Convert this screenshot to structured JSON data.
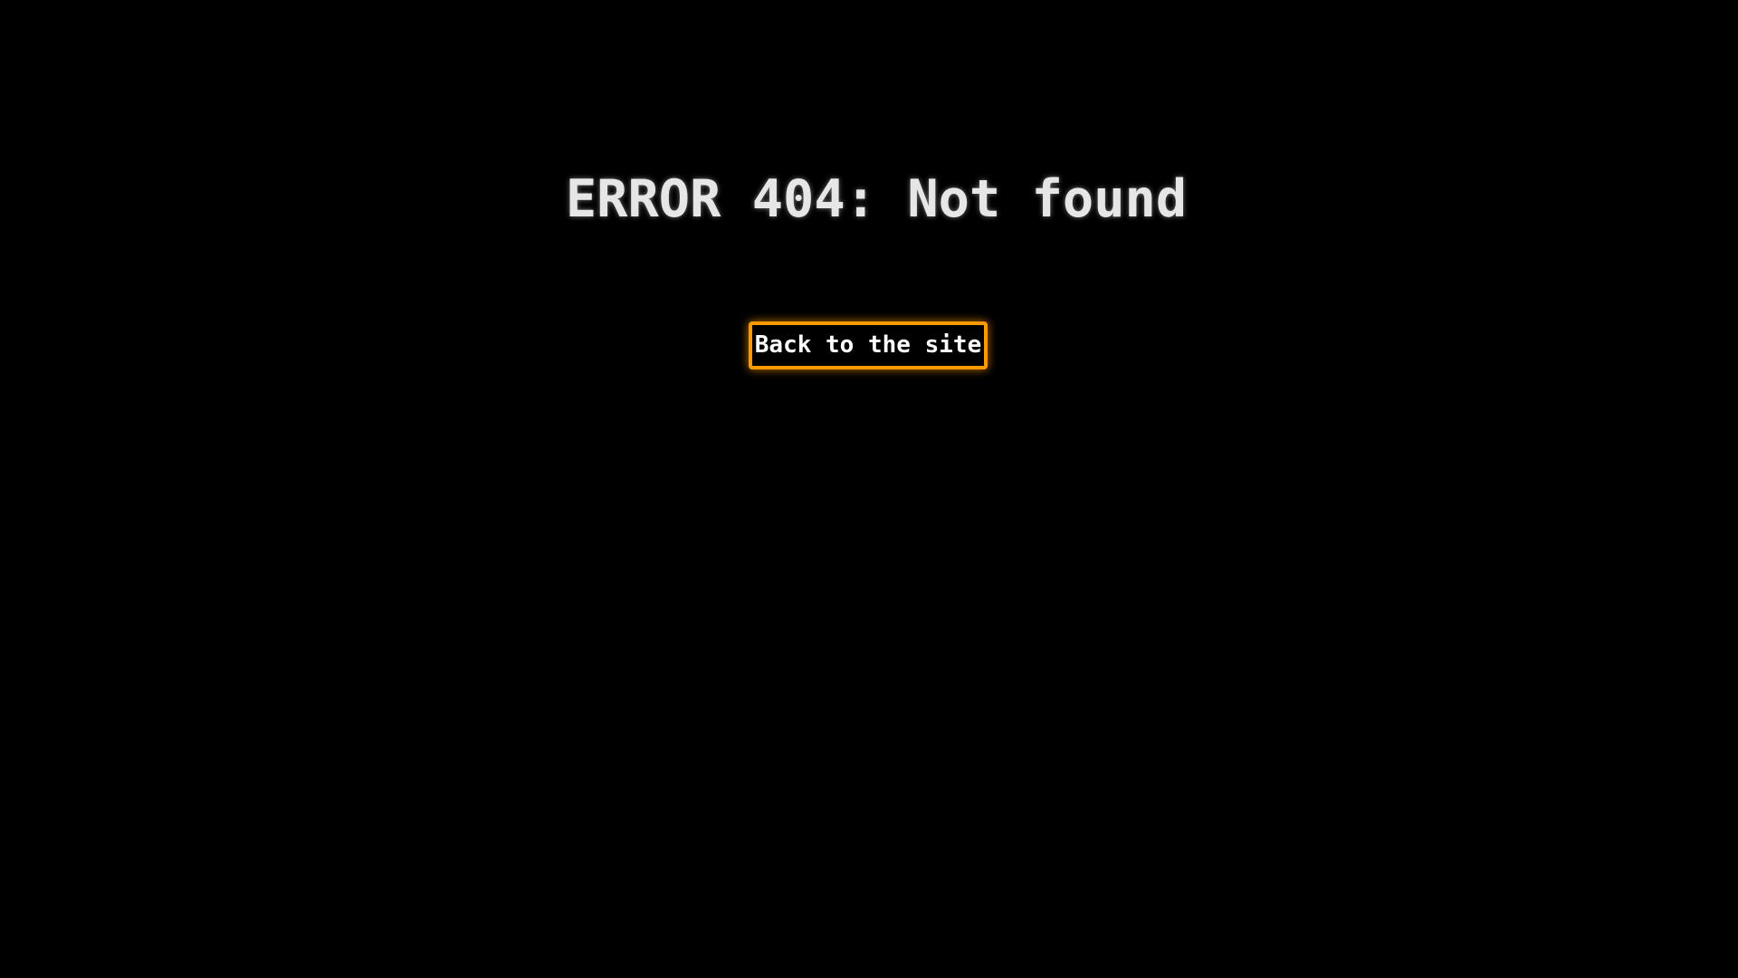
{
  "error": {
    "title": "ERROR 404: Not found"
  },
  "actions": {
    "back_label": "Back to the site"
  },
  "colors": {
    "background": "#000000",
    "title_text": "#e6e6e6",
    "button_border": "#ff9900",
    "button_text": "#ffffff"
  }
}
